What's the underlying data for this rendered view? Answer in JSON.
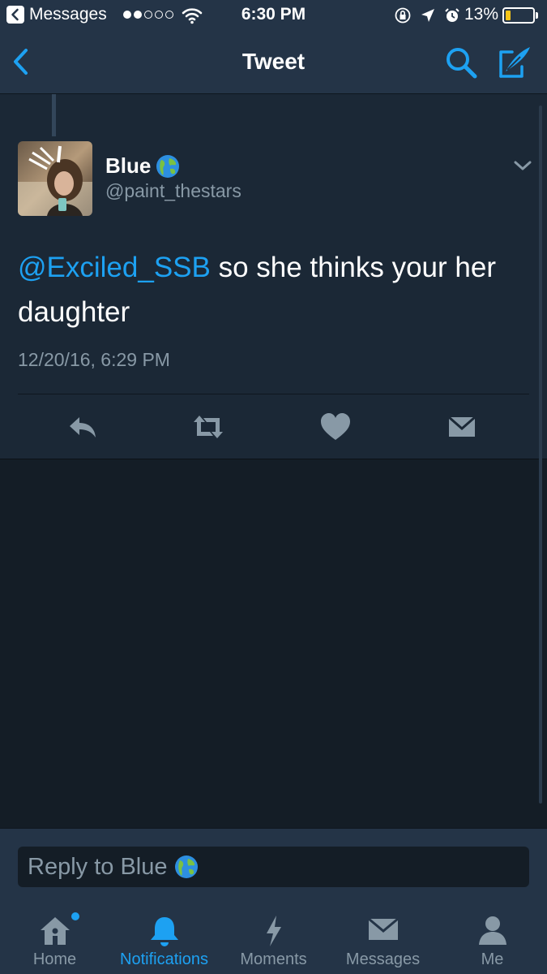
{
  "status_bar": {
    "app_name": "Messages",
    "time": "6:30 PM",
    "battery": "13%",
    "battery_level": 0.13
  },
  "nav": {
    "title": "Tweet",
    "back_icon": "chevron-left-icon",
    "search_icon": "search-icon",
    "compose_icon": "compose-icon"
  },
  "tweet": {
    "display_name": "Blue",
    "display_emoji": "globe-emoji",
    "handle": "@paint_thestars",
    "mention": "@Exciled_SSB",
    "text": " so she thinks your her daughter",
    "timestamp": "12/20/16, 6:29 PM"
  },
  "reply": {
    "placeholder": "Reply to Blue"
  },
  "tabs": [
    {
      "label": "Home",
      "icon": "home-icon",
      "has_dot": true
    },
    {
      "label": "Notifications",
      "icon": "bell-icon",
      "active": true
    },
    {
      "label": "Moments",
      "icon": "lightning-icon"
    },
    {
      "label": "Messages",
      "icon": "envelope-icon"
    },
    {
      "label": "Me",
      "icon": "person-icon"
    }
  ],
  "colors": {
    "accent": "#1da1f2",
    "bar_bg": "#243447",
    "tweet_bg": "#1b2836",
    "page_bg": "#141d26",
    "muted": "#8899a6"
  }
}
